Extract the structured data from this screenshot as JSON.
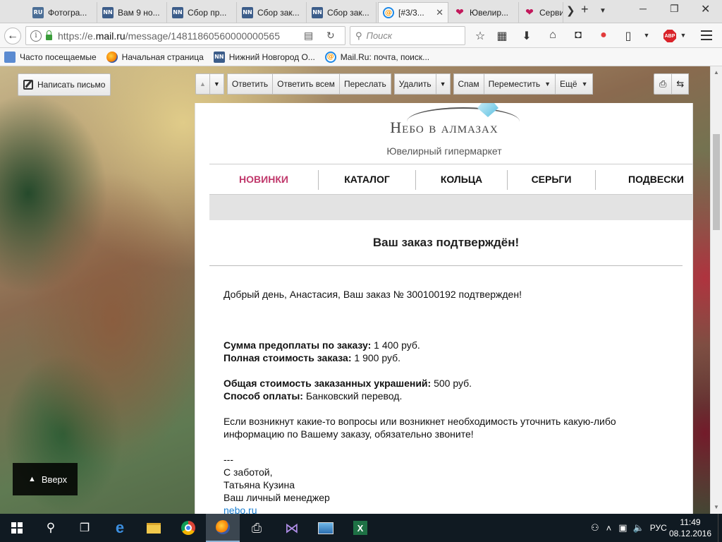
{
  "tabs": [
    {
      "label": "Фотогра...",
      "icon": "ru-favicon",
      "icon_text": "RU"
    },
    {
      "label": "Вам 9 но...",
      "icon": "nn-favicon",
      "icon_text": "NN"
    },
    {
      "label": "Сбор пр...",
      "icon": "nn-favicon",
      "icon_text": "NN"
    },
    {
      "label": "Сбор зак...",
      "icon": "nn-favicon",
      "icon_text": "NN"
    },
    {
      "label": "Сбор зак...",
      "icon": "nn-favicon",
      "icon_text": "NN"
    },
    {
      "label": "[#3/3...",
      "icon": "mailru-favicon",
      "icon_text": "@",
      "active": true
    },
    {
      "label": "Ювелир...",
      "icon": "heart-favicon",
      "icon_text": "❤"
    },
    {
      "label": "Серви",
      "icon": "heart-favicon",
      "icon_text": "❤"
    }
  ],
  "url": {
    "prefix": "https://e.",
    "domain": "mail.ru",
    "path": "/message/14811860560000000565"
  },
  "search": {
    "placeholder": "Поиск"
  },
  "bookmarks": [
    {
      "label": "Часто посещаемые",
      "icon": "folder-icon"
    },
    {
      "label": "Начальная страница",
      "icon": "firefox-icon"
    },
    {
      "label": "Нижний Новгород О...",
      "icon": "nn-favicon",
      "icon_text": "NN"
    },
    {
      "label": "Mail.Ru: почта, поиск...",
      "icon": "mailru-favicon",
      "icon_text": "@"
    }
  ],
  "mail_toolbar": {
    "compose": "Написать письмо",
    "reply": "Ответить",
    "reply_all": "Ответить всем",
    "forward": "Переслать",
    "delete": "Удалить",
    "spam": "Спам",
    "move": "Переместить",
    "more": "Ещё"
  },
  "up_button": "Вверх",
  "email": {
    "brand_name": "Небо в алмазах",
    "brand_sub": "Ювелирный гипермаркет",
    "menu": [
      "НОВИНКИ",
      "КАТАЛОГ",
      "КОЛЬЦА",
      "СЕРЬГИ",
      "ПОДВЕСКИ"
    ],
    "title": "Ваш заказ подтверждён!",
    "greeting": "Добрый день, Анастасия, Ваш заказ № 300100192 подтвержден!",
    "prepay_label": "Сумма предоплаты по заказу:",
    "prepay_value": " 1 400 руб.",
    "total_label": "Полная стоимость заказа:",
    "total_value": " 1 900 руб.",
    "items_label": "Общая стоимость заказанных украшений:",
    "items_value": " 500 руб.",
    "payment_label": "Способ оплаты:",
    "payment_value": " Банковский перевод.",
    "questions_1": "Если возникнут какие-то вопросы или возникнет необходимость уточнить какую-либо",
    "questions_2": "информацию по Вашему заказу, обязательно звоните!",
    "sig_dash": "---",
    "sig_1": "С заботой,",
    "sig_2": "Татьяна Кузина",
    "sig_3": "Ваш личный менеджер",
    "sig_link": "nebo.ru"
  },
  "taskbar": {
    "lang": "РУС",
    "time": "11:49",
    "date": "08.12.2016"
  },
  "colors": {
    "menu_hot": "#c0386b",
    "taskbar": "#101a22",
    "link": "#1a7fd1"
  }
}
